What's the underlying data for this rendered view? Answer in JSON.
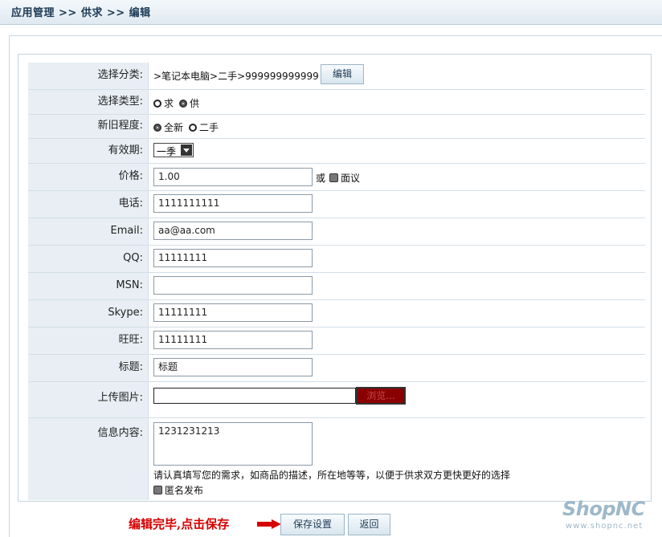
{
  "breadcrumb": "应用管理 >> 供求 >> 编辑",
  "form": {
    "category": {
      "label": "选择分类:",
      "value": ">笔记本电脑>二手>999999999999",
      "edit_button": "编辑"
    },
    "type": {
      "label": "选择类型:",
      "options": [
        "求",
        "供"
      ],
      "selected": "供"
    },
    "condition": {
      "label": "新旧程度:",
      "options": [
        "全新",
        "二手"
      ],
      "selected": "全新"
    },
    "validity": {
      "label": "有效期:",
      "value": "一季"
    },
    "price": {
      "label": "价格:",
      "value": "1.00",
      "or_text": "或",
      "negotiable_label": "面议"
    },
    "phone": {
      "label": "电话:",
      "value": "1111111111"
    },
    "email": {
      "label": "Email:",
      "value": "aa@aa.com"
    },
    "qq": {
      "label": "QQ:",
      "value": "11111111"
    },
    "msn": {
      "label": "MSN:",
      "value": ""
    },
    "skype": {
      "label": "Skype:",
      "value": "11111111"
    },
    "wangwang": {
      "label": "旺旺:",
      "value": "11111111"
    },
    "title": {
      "label": "标题:",
      "value": "标题"
    },
    "upload": {
      "label": "上传图片:",
      "browse_button": "浏览..."
    },
    "content": {
      "label": "信息内容:",
      "value": "1231231213",
      "hint": "请认真填写您的需求，如商品的描述，所在地等等，以便于供求双方更快更好的选择",
      "anonymous_label": "匿名发布"
    }
  },
  "annotation": "编辑完毕,点击保存",
  "actions": {
    "save": "保存设置",
    "back": "返回"
  },
  "watermark": {
    "logo": "ShopNC",
    "url": "www.shopnc.net"
  },
  "colors": {
    "accent_red": "#d60000",
    "browse_button": "#8a0000",
    "label_bg": "#e8eef3"
  }
}
